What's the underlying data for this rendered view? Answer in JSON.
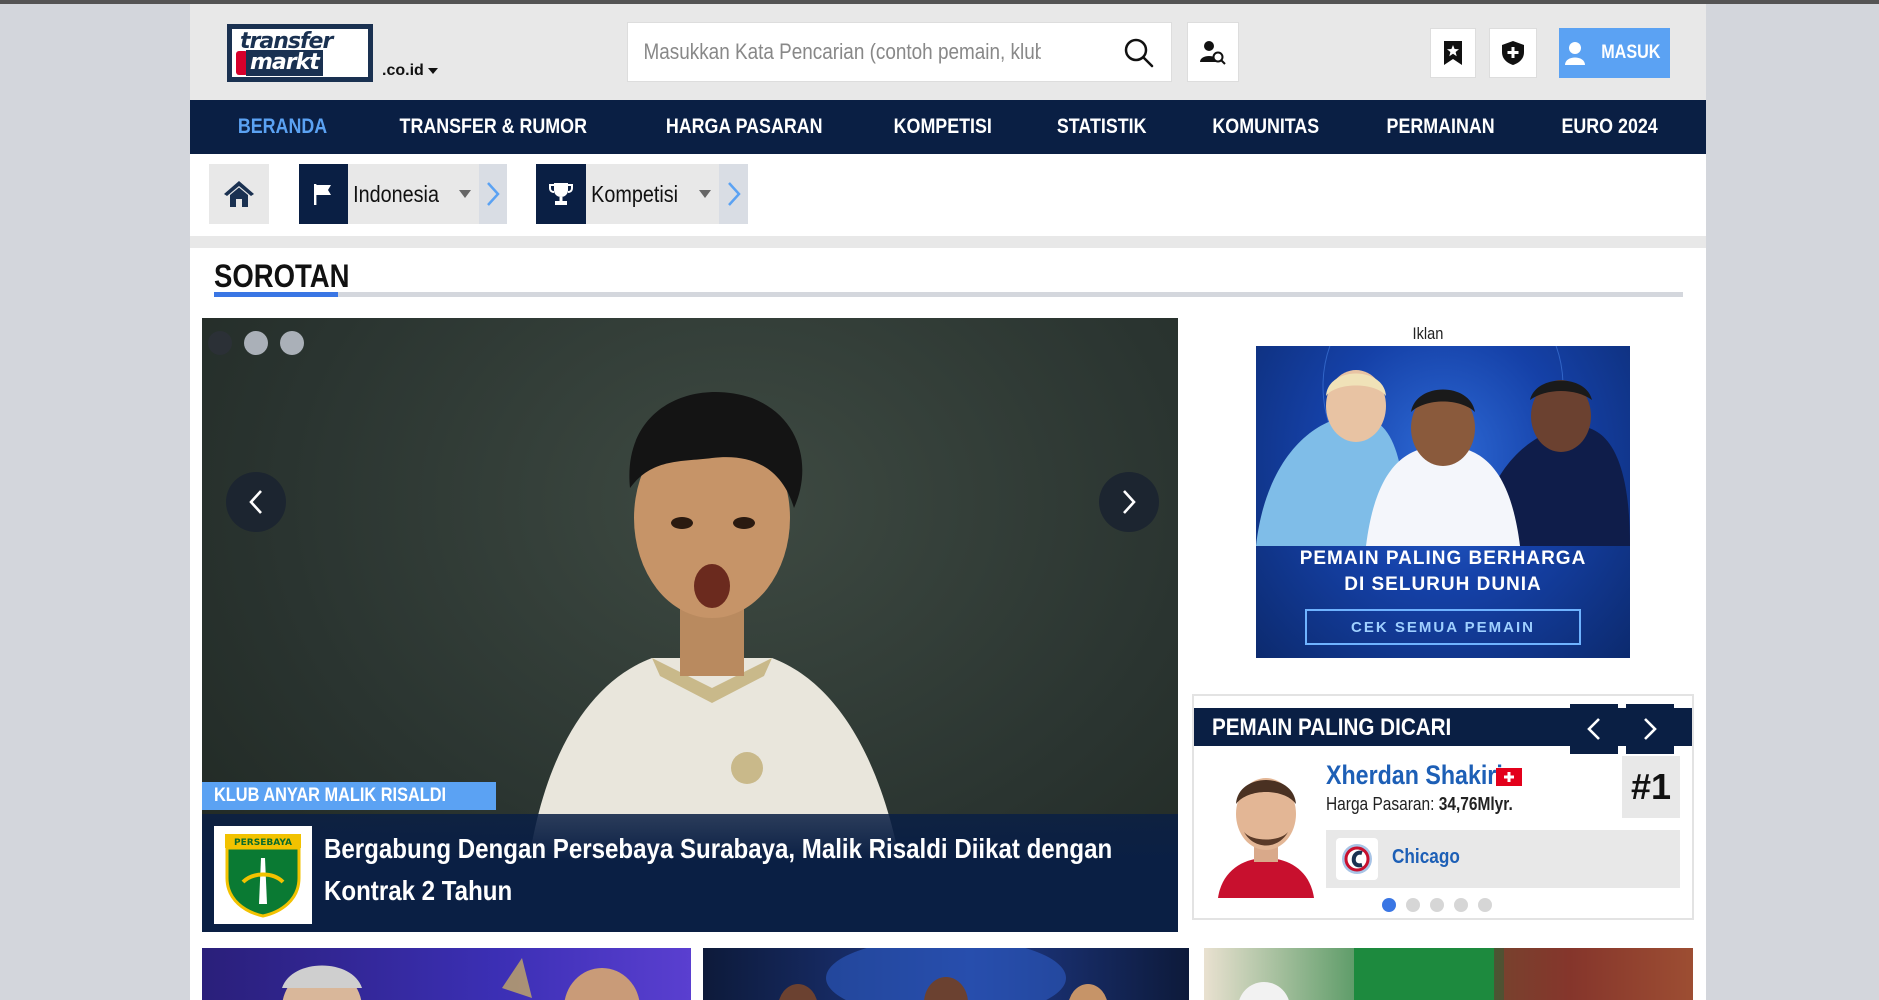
{
  "site": {
    "logo_line1": "transfer",
    "logo_line2": "markt",
    "tld": ".co.id"
  },
  "search": {
    "placeholder": "Masukkan Kata Pencarian (contoh pemain, klub"
  },
  "login": {
    "label": "MASUK"
  },
  "nav": {
    "items": [
      {
        "label": "BERANDA"
      },
      {
        "label": "TRANSFER & RUMOR"
      },
      {
        "label": "HARGA PASARAN"
      },
      {
        "label": "KOMPETISI"
      },
      {
        "label": "STATISTIK"
      },
      {
        "label": "KOMUNITAS"
      },
      {
        "label": "PERMAINAN"
      },
      {
        "label": "EURO 2024"
      }
    ]
  },
  "breadcrumbs": {
    "country": "Indonesia",
    "competition": "Kompetisi"
  },
  "section": {
    "title": "SOROTAN"
  },
  "highlight": {
    "tag": "KLUB ANYAR MALIK RISALDI",
    "headline": "Bergabung Dengan Persebaya Surabaya, Malik Risaldi Diikat dengan Kontrak 2 Tahun",
    "club_logo_text": "PERSEBAYA"
  },
  "ad": {
    "label": "Iklan",
    "line1": "PEMAIN PALING BERHARGA",
    "line2": "DI SELURUH DUNIA",
    "cta": "CEK SEMUA PEMAIN"
  },
  "most_searched": {
    "title": "PEMAIN PALING DICARI",
    "player_name": "Xherdan Shakiri",
    "market_value_label": "Harga Pasaran:",
    "market_value": "34,76Mlyr.",
    "rank": "#1",
    "club": "Chicago"
  },
  "colors": {
    "navy": "#0a1f44",
    "accent_blue": "#5ba2f3",
    "link_blue": "#1d5fb6",
    "section_accent": "#3a76e4"
  }
}
